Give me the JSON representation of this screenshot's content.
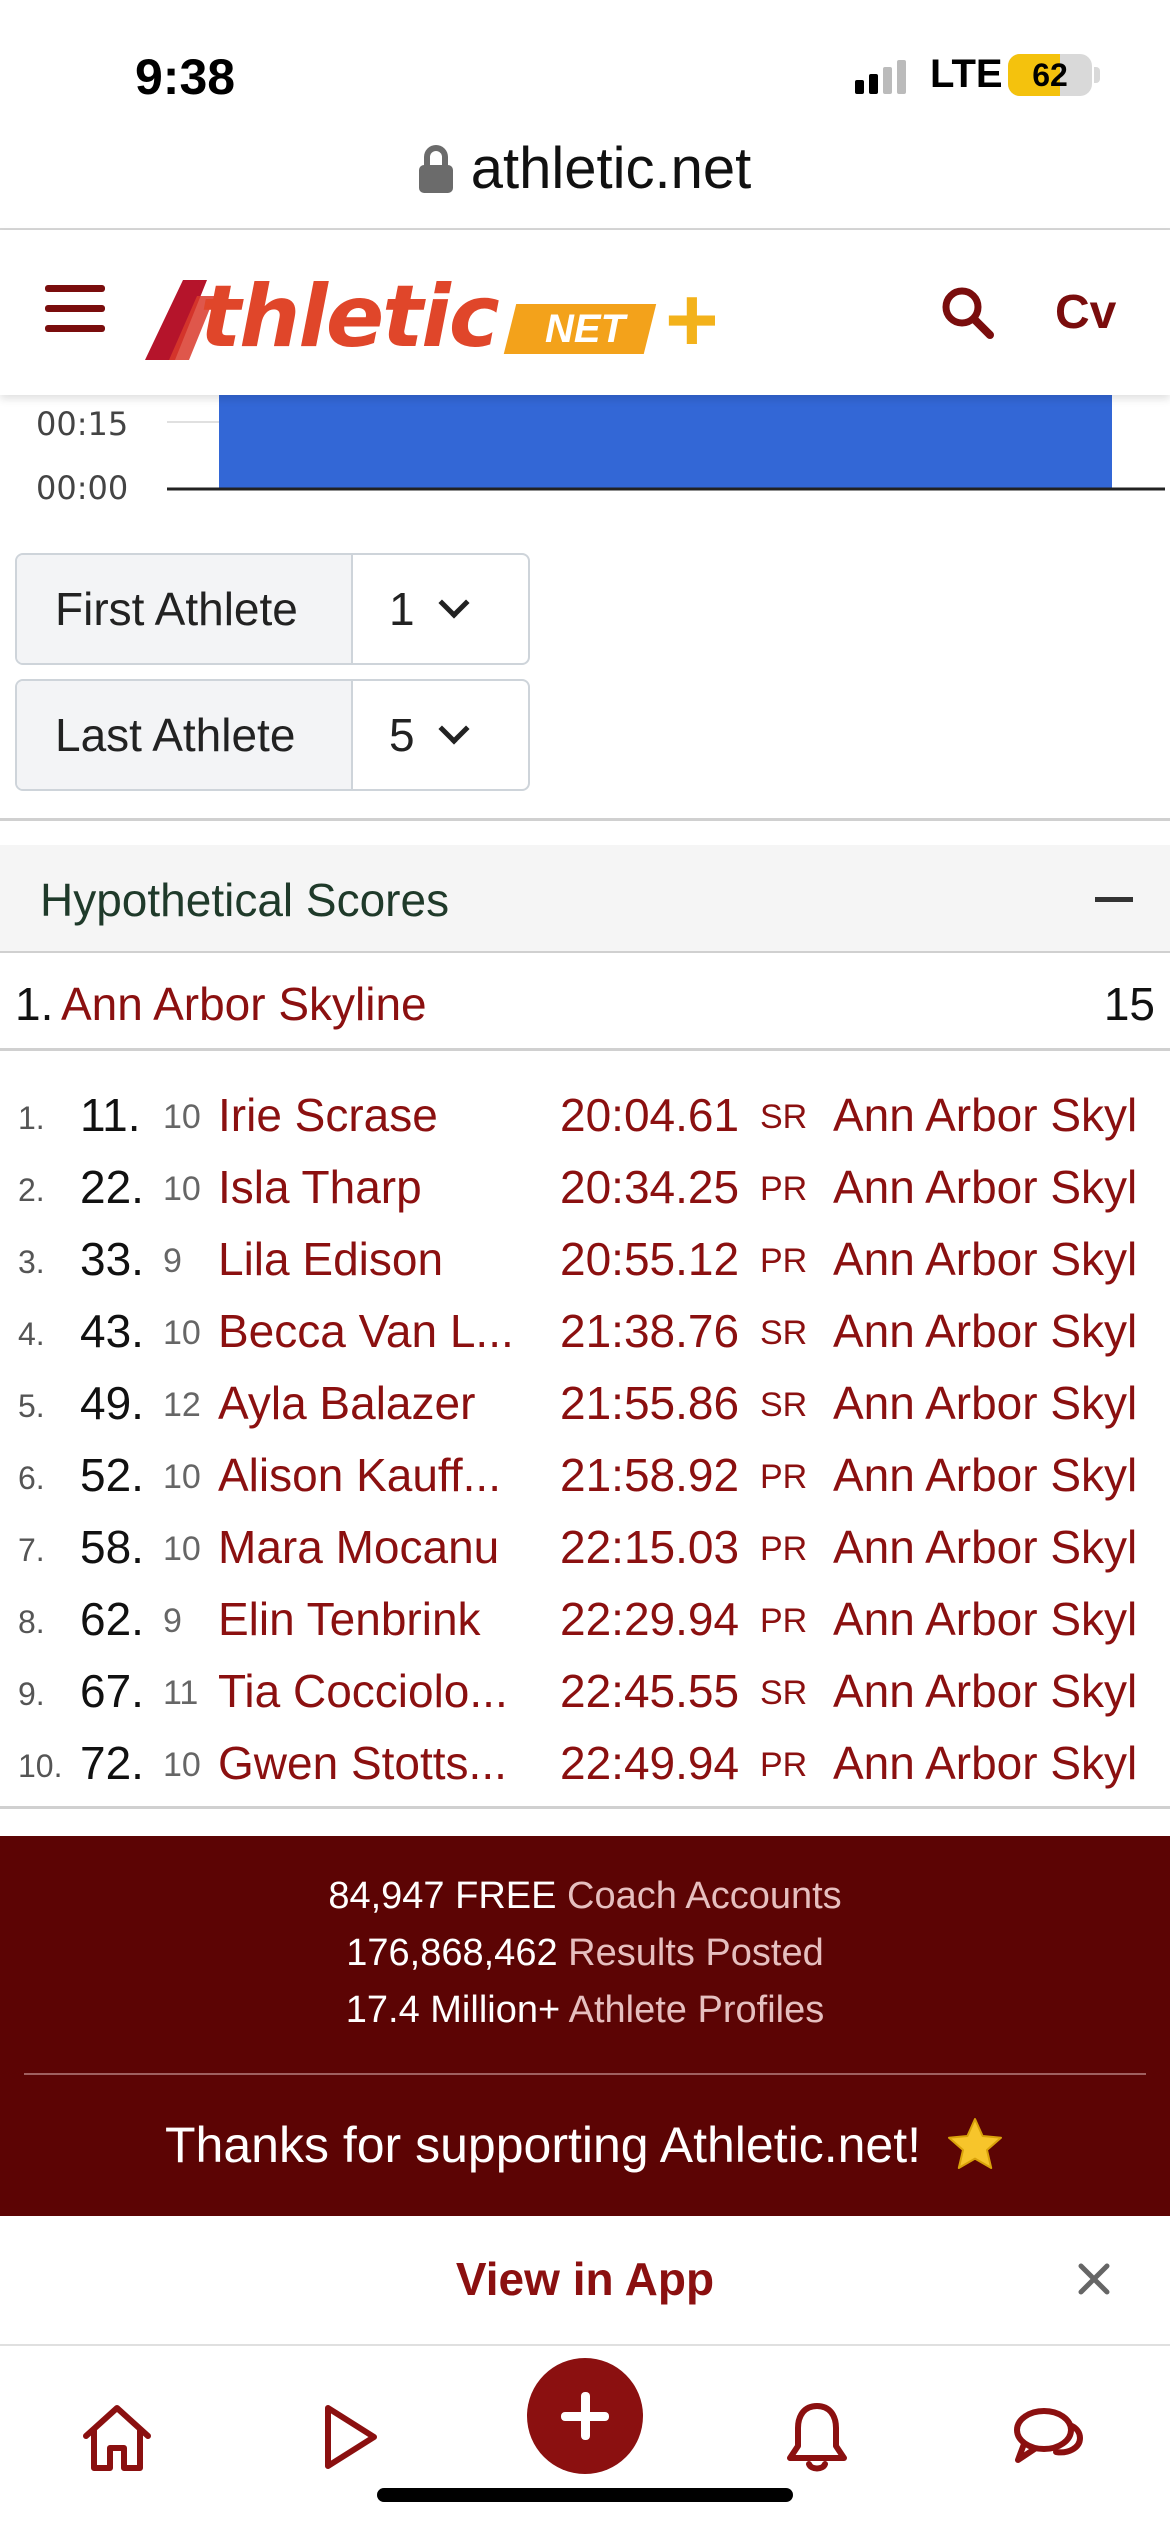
{
  "status_bar": {
    "time": "9:38",
    "network": "LTE",
    "battery": "62",
    "battery_level": 0.62
  },
  "browser": {
    "url": "athletic.net"
  },
  "header": {
    "logo_text": "thletic",
    "logo_net": "NET",
    "logo_plus": "+",
    "user_initials": "Cv",
    "brand_color": "#7a0d0d"
  },
  "chart": {
    "y_ticks": [
      "00:15",
      "00:00"
    ],
    "bar_color": "#3367d6"
  },
  "selectors": {
    "first": {
      "label": "First Athlete",
      "value": "1"
    },
    "last": {
      "label": "Last Athlete",
      "value": "5"
    }
  },
  "scores": {
    "title": "Hypothetical Scores",
    "team": {
      "rank": "1.",
      "name": "Ann Arbor Skyline",
      "score": "15"
    },
    "athletes": [
      {
        "idx": "1.",
        "place": "11.",
        "grade": "10",
        "name": "Irie Scrase",
        "time": "20:04.61",
        "tag": "SR",
        "team": "Ann Arbor Skyl"
      },
      {
        "idx": "2.",
        "place": "22.",
        "grade": "10",
        "name": "Isla Tharp",
        "time": "20:34.25",
        "tag": "PR",
        "team": "Ann Arbor Skyl"
      },
      {
        "idx": "3.",
        "place": "33.",
        "grade": "9",
        "name": "Lila Edison",
        "time": "20:55.12",
        "tag": "PR",
        "team": "Ann Arbor Skyl"
      },
      {
        "idx": "4.",
        "place": "43.",
        "grade": "10",
        "name": "Becca Van L...",
        "time": "21:38.76",
        "tag": "SR",
        "team": "Ann Arbor Skyl"
      },
      {
        "idx": "5.",
        "place": "49.",
        "grade": "12",
        "name": "Ayla Balazer",
        "time": "21:55.86",
        "tag": "SR",
        "team": "Ann Arbor Skyl"
      },
      {
        "idx": "6.",
        "place": "52.",
        "grade": "10",
        "name": "Alison Kauff...",
        "time": "21:58.92",
        "tag": "PR",
        "team": "Ann Arbor Skyl"
      },
      {
        "idx": "7.",
        "place": "58.",
        "grade": "10",
        "name": "Mara Mocanu",
        "time": "22:15.03",
        "tag": "PR",
        "team": "Ann Arbor Skyl"
      },
      {
        "idx": "8.",
        "place": "62.",
        "grade": "9",
        "name": "Elin Tenbrink",
        "time": "22:29.94",
        "tag": "PR",
        "team": "Ann Arbor Skyl"
      },
      {
        "idx": "9.",
        "place": "67.",
        "grade": "11",
        "name": "Tia Cocciolo...",
        "time": "22:45.55",
        "tag": "SR",
        "team": "Ann Arbor Skyl"
      },
      {
        "idx": "10.",
        "place": "72.",
        "grade": "10",
        "name": "Gwen Stotts...",
        "time": "22:49.94",
        "tag": "PR",
        "team": "Ann Arbor Skyl"
      }
    ]
  },
  "footer": {
    "stats": [
      {
        "value": "84,947 FREE",
        "label": "Coach Accounts"
      },
      {
        "value": "176,868,462",
        "label": "Results Posted"
      },
      {
        "value": "17.4 Million+",
        "label": "Athlete Profiles"
      }
    ],
    "thanks": "Thanks for supporting Athletic.net!",
    "background": "#5c0404"
  },
  "app_banner": {
    "label": "View in App"
  },
  "tab_bar": {
    "icons": [
      "home-icon",
      "play-icon",
      "add-icon",
      "bell-icon",
      "chat-icon"
    ]
  }
}
